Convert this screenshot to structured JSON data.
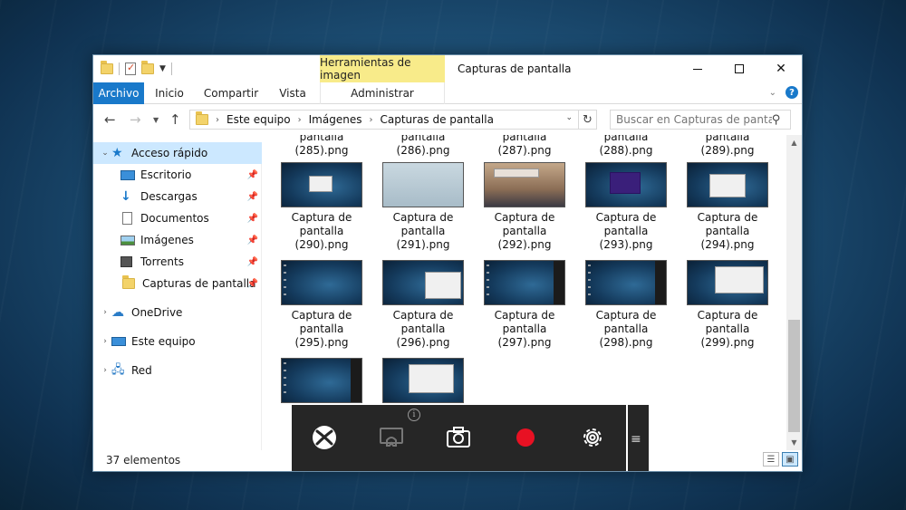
{
  "window": {
    "title": "Capturas de pantalla",
    "tools_header": "Herramientas de imagen"
  },
  "ribbon": {
    "tabs": [
      "Archivo",
      "Inicio",
      "Compartir",
      "Vista",
      "Administrar"
    ]
  },
  "address": {
    "crumbs": [
      "Este equipo",
      "Imágenes",
      "Capturas de pantalla"
    ],
    "search_placeholder": "Buscar en Capturas de pantalla"
  },
  "sidebar": {
    "quick_access": "Acceso rápido",
    "items": [
      {
        "label": "Escritorio",
        "icon": "desktop-icon"
      },
      {
        "label": "Descargas",
        "icon": "download-icon"
      },
      {
        "label": "Documentos",
        "icon": "documents-icon"
      },
      {
        "label": "Imágenes",
        "icon": "pictures-icon"
      },
      {
        "label": "Torrents",
        "icon": "torrent-folder-icon"
      },
      {
        "label": "Capturas de pantalla",
        "icon": "folder-icon"
      }
    ],
    "onedrive": "OneDrive",
    "this_pc": "Este equipo",
    "network": "Red"
  },
  "files": {
    "partial_row": [
      {
        "line1": "pantalla",
        "line2": "(285).png"
      },
      {
        "line1": "pantalla",
        "line2": "(286).png"
      },
      {
        "line1": "pantalla",
        "line2": "(287).png"
      },
      {
        "line1": "pantalla",
        "line2": "(288).png"
      },
      {
        "line1": "pantalla",
        "line2": "(289).png"
      }
    ],
    "rows": [
      [
        {
          "line1": "Captura de",
          "line2": "pantalla",
          "line3": "(290).png"
        },
        {
          "line1": "Captura de",
          "line2": "pantalla",
          "line3": "(291).png"
        },
        {
          "line1": "Captura de",
          "line2": "pantalla",
          "line3": "(292).png"
        },
        {
          "line1": "Captura de",
          "line2": "pantalla",
          "line3": "(293).png"
        },
        {
          "line1": "Captura de",
          "line2": "pantalla",
          "line3": "(294).png"
        }
      ],
      [
        {
          "line1": "Captura de",
          "line2": "pantalla",
          "line3": "(295).png"
        },
        {
          "line1": "Captura de",
          "line2": "pantalla",
          "line3": "(296).png"
        },
        {
          "line1": "Captura de",
          "line2": "pantalla",
          "line3": "(297).png"
        },
        {
          "line1": "Captura de",
          "line2": "pantalla",
          "line3": "(298).png"
        },
        {
          "line1": "Captura de",
          "line2": "pantalla",
          "line3": "(299).png"
        }
      ]
    ]
  },
  "status": {
    "count": "37 elementos"
  },
  "gamebar": {
    "record_color": "#e81123"
  }
}
